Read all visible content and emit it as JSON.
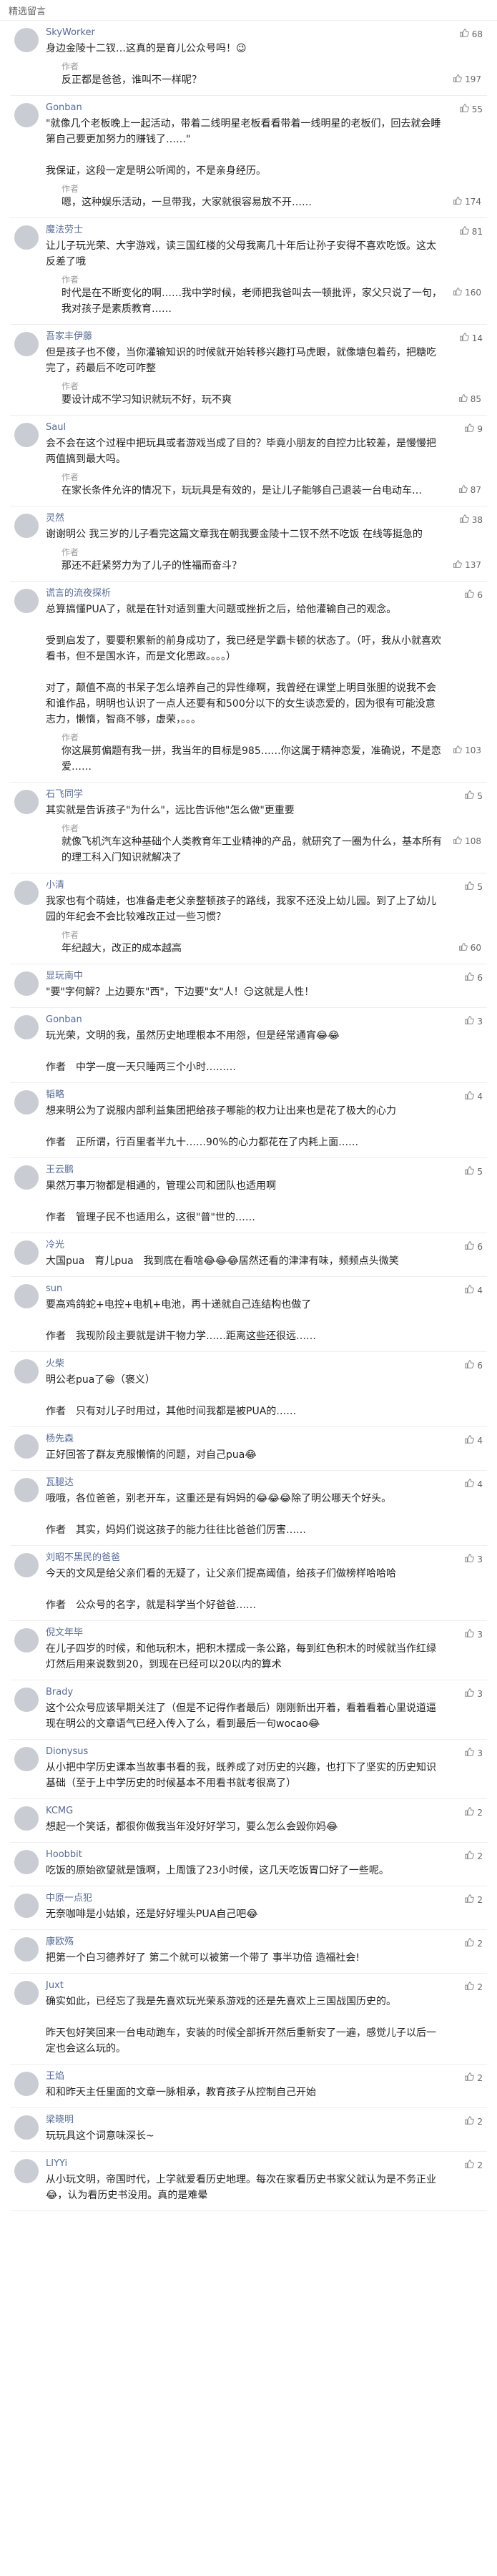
{
  "header": {
    "title": "精选留言"
  },
  "comments": [
    {
      "name": "SkyWorker",
      "text": "身边金陵十二钗…这真的是育儿公众号吗！😉",
      "likes": "68",
      "reply": {
        "tag": "作者",
        "text": "反正都是爸爸，谁叫不一样呢？",
        "likes": "197"
      }
    },
    {
      "name": "Gonban",
      "text": "\"就像几个老板晚上一起活动，带着二线明星老板看看带着一线明星的老板们，回去就会睡第自己要更加努力的赚钱了……\"\n\n我保证，这段一定是明公听闻的，不是亲身经历。",
      "likes": "55",
      "reply": {
        "tag": "作者",
        "text": "嗯，这种娱乐活动，一旦带我，大家就很容易放不开……",
        "likes": "174"
      }
    },
    {
      "name": "魔法劳士",
      "text": "让儿子玩光荣、大宇游戏，读三国红楼的父母我离几十年后让孙子安得不喜欢吃饭。这太反差了哦",
      "likes": "81",
      "reply": {
        "tag": "作者",
        "text": "时代是在不断变化的啊……我中学时候，老师把我爸叫去一顿批评，家父只说了一句，我对孩子是素质教育……",
        "likes": "160"
      }
    },
    {
      "name": "吾家丰伊藤",
      "text": "但是孩子也不傻，当你灌输知识的时候就开始转移兴趣打马虎眼，就像塘包着药，把糖吃完了，药最后不吃可咋整",
      "likes": "14",
      "reply": {
        "tag": "作者",
        "text": "要设计成不学习知识就玩不好，玩不爽",
        "likes": "85"
      }
    },
    {
      "name": "Saul",
      "text": "会不会在这个过程中把玩具或者游戏当成了目的？毕竟小朋友的自控力比较差，是慢慢把两值搞到最大吗。",
      "likes": "9",
      "reply": {
        "tag": "作者",
        "text": "在家长条件允许的情况下，玩玩具是有效的，是让儿子能够自己退装一台电动车…",
        "likes": "87"
      }
    },
    {
      "name": "灵然",
      "text": "谢谢明公 我三岁的儿子看完这篇文章我在朝我要金陵十二钗不然不吃饭 在线等挺急的",
      "likes": "38",
      "reply": {
        "tag": "作者",
        "text": "那还不赶紧努力为了儿子的性福而奋斗？",
        "likes": "137"
      }
    },
    {
      "name": "谎言的流夜探析",
      "text": "总算搞懂PUA了，就是在针对适到重大问题或挫折之后，给他灌输自己的观念。\n\n受到启发了，要要积累新的前身成功了，我已经是学霸卡顿的状态了。（吁，我从小就喜欢看书，但不是国水许，而是文化思政。。。。）\n\n对了，颠值不高的书呆子怎么培养自己的异性缘啊，我曾经在课堂上明目张胆的说我不会和谁作品，明明也认识了一点人还要有和500分以下的女生谈恋爱的，因为很有可能没意志力，懒惰，智商不够，虚荣，。。。",
      "likes": "6",
      "reply": {
        "tag": "作者",
        "text": "你这展剪偏题有我一拼，我当年的目标是985……你这属于精神恋爱，准确说，不是恋爱……",
        "likes": "103"
      }
    },
    {
      "name": "石飞同学",
      "text": "其实就是告诉孩子\"为什么\"，远比告诉他\"怎么做\"更重要",
      "likes": "5",
      "reply": {
        "tag": "作者",
        "text": "就像飞机汽车这种基础个人类教育年工业精神的产品，就研究了一圈为什么，基本所有的理工科入门知识就解决了",
        "likes": "108"
      }
    },
    {
      "name": "小清",
      "text": "我家也有个萌娃，也准备走老父亲整顿孩子的路线，我家不还没上幼儿园。到了上了幼儿园的年纪会不会比较难改正过一些习惯？",
      "likes": "5",
      "reply": {
        "tag": "作者",
        "text": "年纪越大，改正的成本越高",
        "likes": "60"
      }
    },
    {
      "name": "显玩南中",
      "text": "\"要\"字何解？上边要东\"西\"，下边要\"女\"人！😏这就是人性！",
      "likes": "6"
    },
    {
      "name": "Gonban",
      "text": "玩光荣，文明的我，虽然历史地理根本不用怨，但是经常通宵😂😂\n\n作者　中学一度一天只睡两三个小时………",
      "likes": "3"
    },
    {
      "name": "韬略",
      "text": "想来明公为了说服内部利益集团把给孩子哪能的权力让出来也是花了极大的心力\n\n作者　正所谓，行百里者半九十……90%的心力都花在了内耗上面……",
      "likes": "4"
    },
    {
      "name": "王云鹏",
      "text": "果然万事万物都是相通的，管理公司和团队也适用啊\n\n作者　管理子民不也适用么，这很\"普\"世的……",
      "likes": "5"
    },
    {
      "name": "冷光",
      "text": "大国pua　育儿pua　我到底在看啥😂😂😂居然还看的津津有味，频频点头微笑",
      "likes": "6"
    },
    {
      "name": "sun",
      "text": "要高鸡鸽蛇+电控+电机+电池，再十递就自己连结构也做了\n\n作者　我现阶段主要就是讲干物力学……距离这些还很远……",
      "likes": "4"
    },
    {
      "name": "火柴",
      "text": "明公老pua了😁（褒义）\n\n作者　只有对儿子时用过，其他时间我都是被PUA的……",
      "likes": "6"
    },
    {
      "name": "杨先森",
      "text": "正好回答了群友克服懒惰的问题，对自己pua😂",
      "likes": "4"
    },
    {
      "name": "瓦腿达",
      "text": "哦哦，各位爸爸，别老开车，这重还是有妈妈的😂😂😂除了明公哪天个好头。\n\n作者　其实，妈妈们说这孩子的能力往往比爸爸们厉害……",
      "likes": "4"
    },
    {
      "name": "刘昭不黑民的爸爸",
      "text": "今天的文风是给父亲们看的无疑了，让父亲们提高阈值，给孩子们做榜样哈哈哈\n\n作者　公众号的名字，就是科学当个好爸爸……",
      "likes": "3"
    },
    {
      "name": "倪文年毕",
      "text": "在儿子四岁的时候，和他玩积木，把积木摆成一条公路，每到红色积木的时候就当作红绿灯然后用来说数到20，到现在已经可以20以内的算术",
      "likes": "3"
    },
    {
      "name": "Brady",
      "text": "这个公众号应该早期关注了（但是不记得作者最后）刚刚新出开着，看着看着心里说道逼现在明公的文章语气已经入传入了么，看到最后一句wocao😂",
      "likes": "3"
    },
    {
      "name": "Dionysus",
      "text": "从小把中学历史课本当故事书看的我，既养成了对历史的兴趣，也打下了坚实的历史知识基础（至于上中学历史的时候基本不用看书就考很高了）",
      "likes": "3"
    },
    {
      "name": "KCMG",
      "text": "想起一个笑话，都很你做我当年没好好学习，要么怎么会毁你妈😂",
      "likes": "2"
    },
    {
      "name": "Hoobbit",
      "text": "吃饭的原始欲望就是饿啊，上周饿了23小时候，这几天吃饭胃口好了一些呢。",
      "likes": "2"
    },
    {
      "name": "中原一点犯",
      "text": "无奈咖啡是小姑娘，还是好好埋头PUA自己吧😂",
      "likes": "2"
    },
    {
      "name": "康欧殇",
      "text": "把第一个白习德养好了 第二个就可以被第一个带了 事半功倍 造福社会!",
      "likes": "2"
    },
    {
      "name": "Juxt",
      "text": "确实如此，已经忘了我是先喜欢玩光荣系游戏的还是先喜欢上三国战国历史的。\n\n昨天包好笑回来一台电动跑车，安装的时候全部拆开然后重新安了一遍，感觉儿子以后一定也会这么玩的。",
      "likes": "2"
    },
    {
      "name": "王焰",
      "text": "和和昨天主任里面的文章一脉相承，教育孩子从控制自己开始",
      "likes": "2"
    },
    {
      "name": "梁晓明",
      "text": "玩玩具这个词意味深长~",
      "likes": "2"
    },
    {
      "name": "LIYYi",
      "text": "从小玩文明，帝国时代，上学就爱看历史地理。每次在家看历史书家父就认为是不务正业😂，认为看历史书没用。真的是难晕",
      "likes": "2"
    }
  ]
}
